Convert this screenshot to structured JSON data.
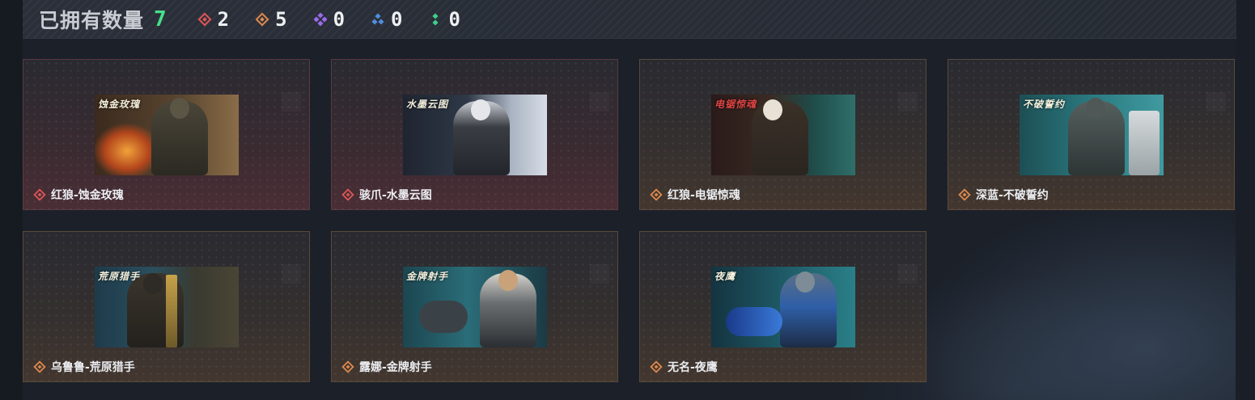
{
  "summary": {
    "label": "已拥有数量",
    "total": "7",
    "stats": [
      {
        "icon": "red-diamond-icon",
        "color": "#e05656",
        "value": "2"
      },
      {
        "icon": "orange-diamond-icon",
        "color": "#e08a4e",
        "value": "5"
      },
      {
        "icon": "purple-diamond-icon",
        "color": "#9a6be8",
        "value": "0"
      },
      {
        "icon": "blue-diamond-icon",
        "color": "#4f8fe0",
        "value": "0"
      },
      {
        "icon": "green-diamond-icon",
        "color": "#3fd08a",
        "value": "0"
      }
    ]
  },
  "cards": [
    {
      "name": "红狼-蚀金玫瑰",
      "tag": "蚀金玫瑰",
      "rarity": "red",
      "icon_color": "#e05656"
    },
    {
      "name": "骇爪-水墨云图",
      "tag": "水墨云图",
      "rarity": "red",
      "icon_color": "#e05656"
    },
    {
      "name": "红狼-电锯惊魂",
      "tag": "电锯惊魂",
      "rarity": "orange",
      "icon_color": "#e08a4e"
    },
    {
      "name": "深蓝-不破誓约",
      "tag": "不破誓约",
      "rarity": "orange",
      "icon_color": "#e08a4e"
    },
    {
      "name": "乌鲁鲁-荒原猎手",
      "tag": "荒原猎手",
      "rarity": "orange",
      "icon_color": "#e08a4e"
    },
    {
      "name": "露娜-金牌射手",
      "tag": "金牌射手",
      "rarity": "orange",
      "icon_color": "#e08a4e"
    },
    {
      "name": "无名-夜鹰",
      "tag": "夜鹰",
      "rarity": "orange",
      "icon_color": "#e08a4e"
    }
  ]
}
